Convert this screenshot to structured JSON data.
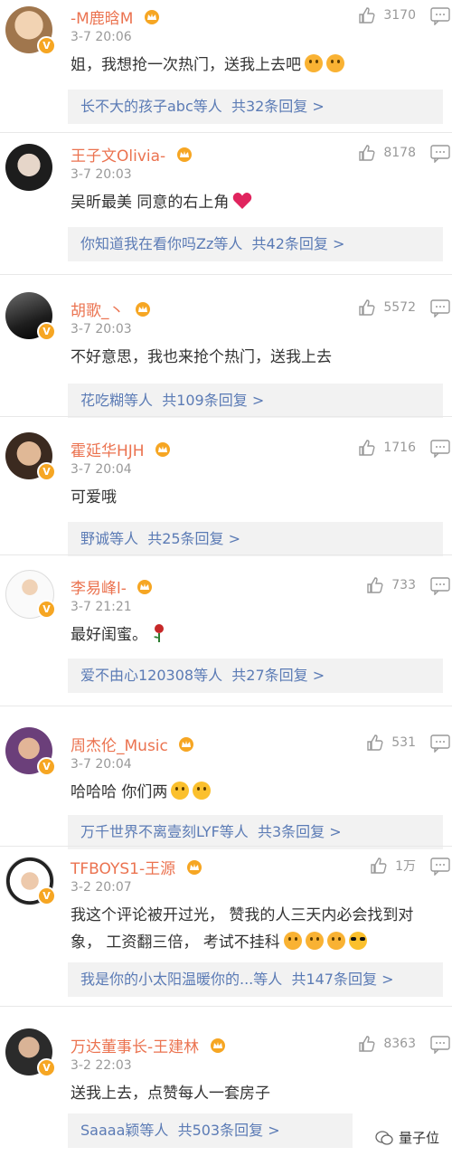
{
  "comments": [
    {
      "name": "-M鹿晗M",
      "time": "3-7 20:06",
      "likes": "3170",
      "text": "姐，我想抢一次热门，送我上去吧",
      "reply_users": "长不大的孩子abc等人",
      "reply_count": "共32条回复 >",
      "avatar_color": "#d9b48a"
    },
    {
      "name": "王子文Olivia-",
      "time": "3-7 20:03",
      "likes": "8178",
      "text": "吴昕最美 同意的右上角",
      "reply_users": "你知道我在看你吗Zz等人",
      "reply_count": "共42条回复 >",
      "avatar_color": "#2b2b2b"
    },
    {
      "name": "胡歌_丶",
      "time": "3-7 20:03",
      "likes": "5572",
      "text": "不好意思，我也来抢个热门，送我上去",
      "reply_users": "花吃糊等人",
      "reply_count": "共109条回复 >",
      "avatar_color": "#3a3a3a"
    },
    {
      "name": "霍延华HJH",
      "time": "3-7 20:04",
      "likes": "1716",
      "text": "可爱哦",
      "reply_users": "野诚等人",
      "reply_count": "共25条回复 >",
      "avatar_color": "#6a5040"
    },
    {
      "name": "李易峰l-",
      "time": "3-7 21:21",
      "likes": "733",
      "text": "最好闺蜜。",
      "reply_users": "爱不由心120308等人",
      "reply_count": "共27条回复 >",
      "avatar_color": "#e8e8e8"
    },
    {
      "name": "周杰伦_Music",
      "time": "3-7 20:04",
      "likes": "531",
      "text": "哈哈哈  你们两",
      "reply_users": "万千世界不离壹刻LYF等人",
      "reply_count": "共3条回复 >",
      "avatar_color": "#7a4a8a"
    },
    {
      "name": "TFBOYS1-王源",
      "time": "3-2 20:07",
      "likes": "1万",
      "text": "我这个评论被开过光， 赞我的人三天内必会找到对象， 工资翻三倍， 考试不挂科",
      "reply_users": "我是你的小太阳温暖你的...等人",
      "reply_count": "共147条回复 >",
      "avatar_color": "#d8d8d8"
    },
    {
      "name": "万达董事长-王建林",
      "time": "3-2 22:03",
      "likes": "8363",
      "text": "送我上去，点赞每人一套房子",
      "reply_users": "Saaaa颖等人",
      "reply_count": "共503条回复 >",
      "avatar_color": "#4a4a4a"
    }
  ],
  "watermark": "量子位",
  "colors": {
    "name": "#eb7350",
    "link": "#5b7bb5",
    "meta": "#999999",
    "badge": "#f6a623"
  },
  "icons": [
    "thumb-up-icon",
    "reply-icon",
    "verified-badge-icon",
    "member-crown-icon",
    "emoji-icon",
    "heart-icon",
    "rose-icon",
    "wechat-icon"
  ]
}
